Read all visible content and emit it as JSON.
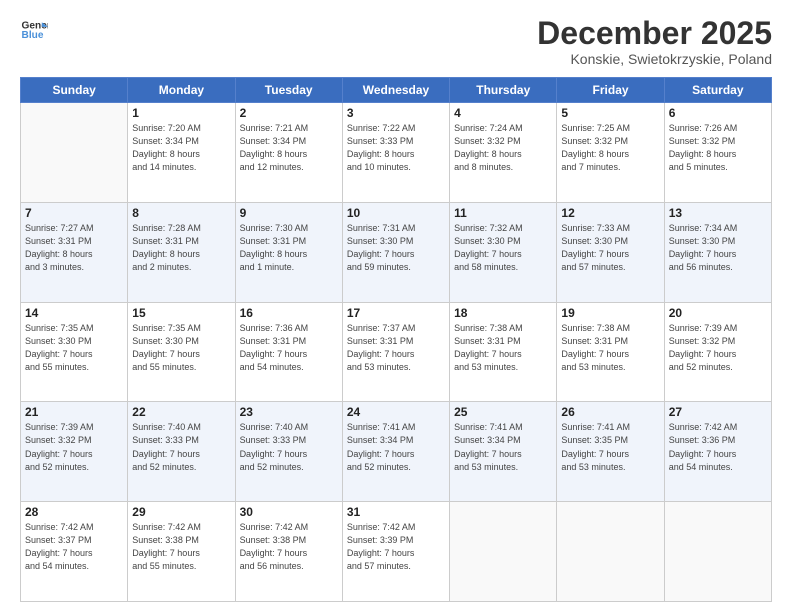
{
  "header": {
    "logo_line1": "General",
    "logo_line2": "Blue",
    "month_title": "December 2025",
    "location": "Konskie, Swietokrzyskie, Poland"
  },
  "weekdays": [
    "Sunday",
    "Monday",
    "Tuesday",
    "Wednesday",
    "Thursday",
    "Friday",
    "Saturday"
  ],
  "weeks": [
    [
      {
        "day": "",
        "info": ""
      },
      {
        "day": "1",
        "info": "Sunrise: 7:20 AM\nSunset: 3:34 PM\nDaylight: 8 hours\nand 14 minutes."
      },
      {
        "day": "2",
        "info": "Sunrise: 7:21 AM\nSunset: 3:34 PM\nDaylight: 8 hours\nand 12 minutes."
      },
      {
        "day": "3",
        "info": "Sunrise: 7:22 AM\nSunset: 3:33 PM\nDaylight: 8 hours\nand 10 minutes."
      },
      {
        "day": "4",
        "info": "Sunrise: 7:24 AM\nSunset: 3:32 PM\nDaylight: 8 hours\nand 8 minutes."
      },
      {
        "day": "5",
        "info": "Sunrise: 7:25 AM\nSunset: 3:32 PM\nDaylight: 8 hours\nand 7 minutes."
      },
      {
        "day": "6",
        "info": "Sunrise: 7:26 AM\nSunset: 3:32 PM\nDaylight: 8 hours\nand 5 minutes."
      }
    ],
    [
      {
        "day": "7",
        "info": "Sunrise: 7:27 AM\nSunset: 3:31 PM\nDaylight: 8 hours\nand 3 minutes."
      },
      {
        "day": "8",
        "info": "Sunrise: 7:28 AM\nSunset: 3:31 PM\nDaylight: 8 hours\nand 2 minutes."
      },
      {
        "day": "9",
        "info": "Sunrise: 7:30 AM\nSunset: 3:31 PM\nDaylight: 8 hours\nand 1 minute."
      },
      {
        "day": "10",
        "info": "Sunrise: 7:31 AM\nSunset: 3:30 PM\nDaylight: 7 hours\nand 59 minutes."
      },
      {
        "day": "11",
        "info": "Sunrise: 7:32 AM\nSunset: 3:30 PM\nDaylight: 7 hours\nand 58 minutes."
      },
      {
        "day": "12",
        "info": "Sunrise: 7:33 AM\nSunset: 3:30 PM\nDaylight: 7 hours\nand 57 minutes."
      },
      {
        "day": "13",
        "info": "Sunrise: 7:34 AM\nSunset: 3:30 PM\nDaylight: 7 hours\nand 56 minutes."
      }
    ],
    [
      {
        "day": "14",
        "info": "Sunrise: 7:35 AM\nSunset: 3:30 PM\nDaylight: 7 hours\nand 55 minutes."
      },
      {
        "day": "15",
        "info": "Sunrise: 7:35 AM\nSunset: 3:30 PM\nDaylight: 7 hours\nand 55 minutes."
      },
      {
        "day": "16",
        "info": "Sunrise: 7:36 AM\nSunset: 3:31 PM\nDaylight: 7 hours\nand 54 minutes."
      },
      {
        "day": "17",
        "info": "Sunrise: 7:37 AM\nSunset: 3:31 PM\nDaylight: 7 hours\nand 53 minutes."
      },
      {
        "day": "18",
        "info": "Sunrise: 7:38 AM\nSunset: 3:31 PM\nDaylight: 7 hours\nand 53 minutes."
      },
      {
        "day": "19",
        "info": "Sunrise: 7:38 AM\nSunset: 3:31 PM\nDaylight: 7 hours\nand 53 minutes."
      },
      {
        "day": "20",
        "info": "Sunrise: 7:39 AM\nSunset: 3:32 PM\nDaylight: 7 hours\nand 52 minutes."
      }
    ],
    [
      {
        "day": "21",
        "info": "Sunrise: 7:39 AM\nSunset: 3:32 PM\nDaylight: 7 hours\nand 52 minutes."
      },
      {
        "day": "22",
        "info": "Sunrise: 7:40 AM\nSunset: 3:33 PM\nDaylight: 7 hours\nand 52 minutes."
      },
      {
        "day": "23",
        "info": "Sunrise: 7:40 AM\nSunset: 3:33 PM\nDaylight: 7 hours\nand 52 minutes."
      },
      {
        "day": "24",
        "info": "Sunrise: 7:41 AM\nSunset: 3:34 PM\nDaylight: 7 hours\nand 52 minutes."
      },
      {
        "day": "25",
        "info": "Sunrise: 7:41 AM\nSunset: 3:34 PM\nDaylight: 7 hours\nand 53 minutes."
      },
      {
        "day": "26",
        "info": "Sunrise: 7:41 AM\nSunset: 3:35 PM\nDaylight: 7 hours\nand 53 minutes."
      },
      {
        "day": "27",
        "info": "Sunrise: 7:42 AM\nSunset: 3:36 PM\nDaylight: 7 hours\nand 54 minutes."
      }
    ],
    [
      {
        "day": "28",
        "info": "Sunrise: 7:42 AM\nSunset: 3:37 PM\nDaylight: 7 hours\nand 54 minutes."
      },
      {
        "day": "29",
        "info": "Sunrise: 7:42 AM\nSunset: 3:38 PM\nDaylight: 7 hours\nand 55 minutes."
      },
      {
        "day": "30",
        "info": "Sunrise: 7:42 AM\nSunset: 3:38 PM\nDaylight: 7 hours\nand 56 minutes."
      },
      {
        "day": "31",
        "info": "Sunrise: 7:42 AM\nSunset: 3:39 PM\nDaylight: 7 hours\nand 57 minutes."
      },
      {
        "day": "",
        "info": ""
      },
      {
        "day": "",
        "info": ""
      },
      {
        "day": "",
        "info": ""
      }
    ]
  ]
}
